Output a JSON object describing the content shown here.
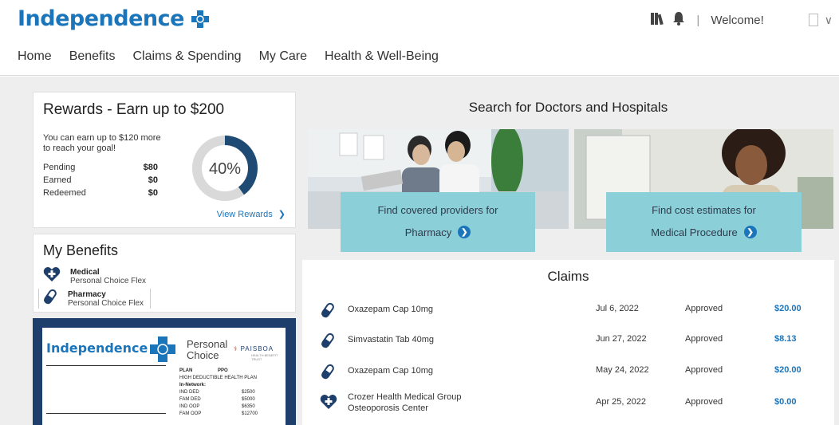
{
  "header": {
    "logo_text": "Independence",
    "welcome": "Welcome!",
    "separator": "|"
  },
  "nav": [
    "Home",
    "Benefits",
    "Claims & Spending",
    "My Care",
    "Health & Well-Being"
  ],
  "rewards": {
    "title": "Rewards - Earn up to $200",
    "subtext": "You can earn up to $120 more to reach your goal!",
    "rows": [
      {
        "label": "Pending",
        "value": "$80"
      },
      {
        "label": "Earned",
        "value": "$0"
      },
      {
        "label": "Redeemed",
        "value": "$0"
      }
    ],
    "percent_label": "40%",
    "percent": 0.4,
    "link": "View Rewards",
    "accent_color": "#1e4a73"
  },
  "benefits": {
    "title": "My Benefits",
    "items": [
      {
        "name": "Medical",
        "plan": "Personal Choice Flex",
        "icon": "heart-cross-icon"
      },
      {
        "name": "Pharmacy",
        "plan": "Personal Choice Flex",
        "icon": "pill-icon"
      }
    ]
  },
  "id_card": {
    "brand": "Independence",
    "product": "Personal Choice",
    "partner": "PAISBOA",
    "partner_sub": "HEALTH BENEFIT TRUST",
    "plan_label": "PLAN",
    "plan_value": "PPO",
    "plan_type": "HIGH DEDUCTIBLE HEALTH PLAN",
    "network_label": "In-Network:",
    "rows": [
      {
        "label": "IND DED",
        "value": "$2500"
      },
      {
        "label": "FAM DED",
        "value": "$5000"
      },
      {
        "label": "IND OOP",
        "value": "$6350"
      },
      {
        "label": "FAM OOP",
        "value": "$12700"
      }
    ]
  },
  "search": {
    "title": "Search for Doctors and Hospitals",
    "cards": [
      {
        "line1": "Find covered providers for",
        "line2": "Pharmacy"
      },
      {
        "line1": "Find cost estimates for",
        "line2": "Medical Procedure"
      }
    ]
  },
  "claims": {
    "title": "Claims",
    "rows": [
      {
        "name": "Oxazepam Cap 10mg",
        "name2": "",
        "date": "Jul 6, 2022",
        "status": "Approved",
        "amount": "$20.00",
        "icon": "pill-icon"
      },
      {
        "name": "Simvastatin Tab 40mg",
        "name2": "",
        "date": "Jun 27, 2022",
        "status": "Approved",
        "amount": "$8.13",
        "icon": "pill-icon"
      },
      {
        "name": "Oxazepam Cap 10mg",
        "name2": "",
        "date": "May 24, 2022",
        "status": "Approved",
        "amount": "$20.00",
        "icon": "pill-icon"
      },
      {
        "name": "Crozer Health Medical Group",
        "name2": "Osteoporosis Center",
        "date": "Apr 25, 2022",
        "status": "Approved",
        "amount": "$0.00",
        "icon": "heart-cross-icon"
      }
    ]
  },
  "colors": {
    "brand_blue": "#1b75bb",
    "teal": "#8bcfd9",
    "navy": "#1e3f6b"
  }
}
